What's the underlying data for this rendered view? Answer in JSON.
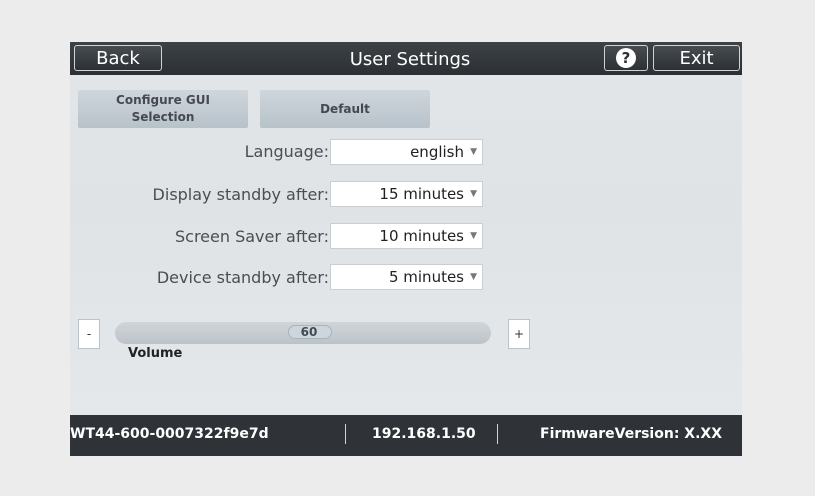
{
  "titlebar": {
    "back_label": "Back",
    "title": "User Settings",
    "help_icon": "?",
    "exit_label": "Exit"
  },
  "buttons": {
    "configure_gui": "Configure GUI Selection",
    "default": "Default"
  },
  "settings": [
    {
      "label": "Language:",
      "value": "english"
    },
    {
      "label": "Display standby after:",
      "value": "15 minutes"
    },
    {
      "label": "Screen Saver after:",
      "value": "10 minutes"
    },
    {
      "label": "Device standby after:",
      "value": "5 minutes"
    }
  ],
  "volume": {
    "minus_label": "-",
    "plus_label": "+",
    "value": "60",
    "label": "Volume"
  },
  "statusbar": {
    "device_id": "WT44-600-0007322f9e7d",
    "ip_address": "192.168.1.50",
    "firmware": "FirmwareVersion: X.XX"
  },
  "colors": {
    "titlebar": "#2c3034",
    "screen_bg": "#e3e6e8",
    "button_bg": "#b8c2ca",
    "statusbar": "#2f3337"
  }
}
